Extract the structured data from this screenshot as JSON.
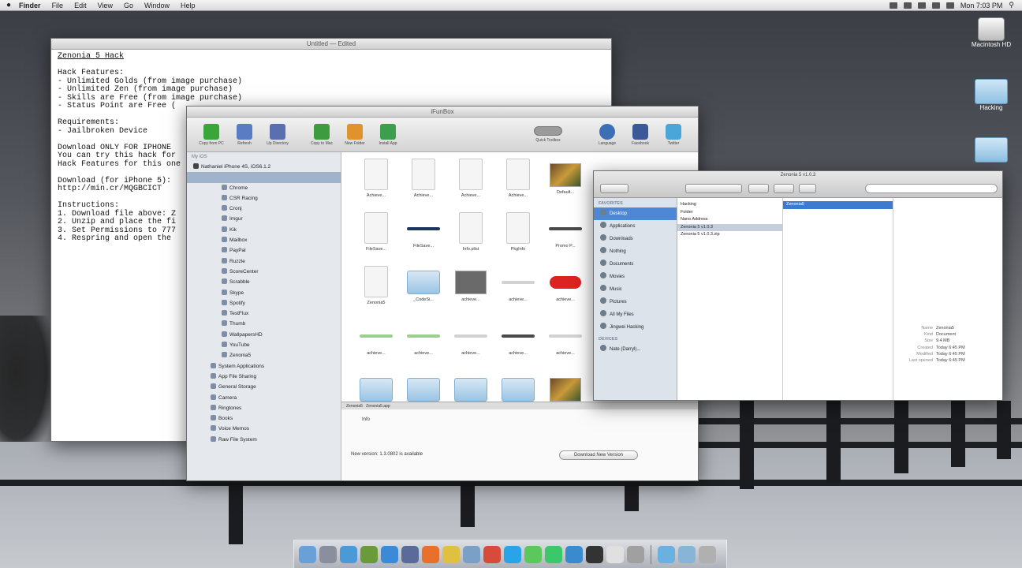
{
  "menubar": {
    "app": "Finder",
    "items": [
      "File",
      "Edit",
      "View",
      "Go",
      "Window",
      "Help"
    ],
    "clock": "Mon 7:03 PM"
  },
  "desktop": {
    "icons": [
      {
        "label": "Macintosh HD",
        "kind": "drive"
      },
      {
        "label": "Hacking",
        "kind": "folder"
      },
      {
        "label": "",
        "kind": "folder"
      }
    ]
  },
  "textedit": {
    "title": "Untitled — Edited",
    "lines": [
      "Zenonia 5 Hack",
      "",
      "Hack Features:",
      "- Unlimited Golds (from image purchase)",
      "- Unlimited Zen (from image purchase)",
      "- Skills are Free (from image purchase)",
      "- Status Point are Free (",
      "",
      "Requirements:",
      "- Jailbroken Device",
      "",
      "Download ONLY FOR IPHONE",
      "You can try this hack for",
      "Hack Features for this one",
      "",
      "Download (for iPhone 5):",
      "http://min.cr/MQGBCICT",
      "",
      "Instructions:",
      "1. Download file above: Z",
      "2. Unzip and place the fi",
      "3. Set Permissions to 777",
      "4. Respring and open the"
    ]
  },
  "ifunbox": {
    "title": "iFunBox",
    "toolbar": [
      {
        "label": "Copy from PC",
        "icon": "plus-icon",
        "color": "#3aa63a"
      },
      {
        "label": "Refresh",
        "icon": "refresh-icon",
        "color": "#5a7cc2"
      },
      {
        "label": "Up Directory",
        "icon": "up-arrow-icon",
        "color": "#5a6fb0"
      },
      {
        "label": "Copy to Mac",
        "icon": "download-icon",
        "color": "#3f9b3f"
      },
      {
        "label": "New Folder",
        "icon": "folder-new-icon",
        "color": "#e0932d"
      },
      {
        "label": "Install App",
        "icon": "install-icon",
        "color": "#3d9f4e"
      }
    ],
    "toolbar_right": [
      {
        "label": "Language",
        "icon": "globe-icon",
        "color": "#3b6fb6"
      },
      {
        "label": "Facebook",
        "icon": "facebook-icon",
        "color": "#3b5998"
      },
      {
        "label": "Twitter",
        "icon": "twitter-icon",
        "color": "#4aa6d9"
      }
    ],
    "toolbar_toggle_label": "Quick Toolbox",
    "sidebar_header": "My iOS",
    "device": "Nathaniel iPhone 4S, iOS6.1.2",
    "sidebar_items": [
      "Chrome",
      "CSR Racing",
      "Cronj",
      "Imgur",
      "Kik",
      "Mailbox",
      "PayPal",
      "Ruzzle",
      "ScoreCenter",
      "Scrabble",
      "Skype",
      "Spotify",
      "TestFlux",
      "Thumb",
      "WallpapersHD",
      "YouTube",
      "Zenonia5"
    ],
    "sidebar_groups": [
      "System Applications",
      "App File Sharing",
      "General Storage",
      "Camera",
      "Ringtones",
      "Books",
      "Voice Memos",
      "Raw File System"
    ],
    "grid": [
      {
        "label": "Achieve...",
        "kind": "doc"
      },
      {
        "label": "Achieve...",
        "kind": "doc"
      },
      {
        "label": "Achieve...",
        "kind": "doc"
      },
      {
        "label": "Achieve...",
        "kind": "doc"
      },
      {
        "label": "Default...",
        "kind": "img"
      },
      {
        "label": "FileSave...",
        "kind": "doc"
      },
      {
        "label": "FileSave...",
        "kind": "line-navy"
      },
      {
        "label": "Info.plist",
        "kind": "doc"
      },
      {
        "label": "PkgInfo",
        "kind": "doc"
      },
      {
        "label": "Promo P...",
        "kind": "line-dark"
      },
      {
        "label": "Zenonia5",
        "kind": "doc"
      },
      {
        "label": "_CodeSi...",
        "kind": "folder"
      },
      {
        "label": "achieve...",
        "kind": "gray-box"
      },
      {
        "label": "achieve...",
        "kind": "line-light"
      },
      {
        "label": "achieve...",
        "kind": "red-btn"
      },
      {
        "label": "achieve...",
        "kind": "line-green"
      },
      {
        "label": "achieve...",
        "kind": "line-green"
      },
      {
        "label": "achieve...",
        "kind": "line-light"
      },
      {
        "label": "achieve...",
        "kind": "line-dark"
      },
      {
        "label": "achieve...",
        "kind": "line-light"
      },
      {
        "label": "",
        "kind": "folder"
      },
      {
        "label": "",
        "kind": "folder"
      },
      {
        "label": "",
        "kind": "folder"
      },
      {
        "label": "",
        "kind": "folder"
      },
      {
        "label": "",
        "kind": "img"
      }
    ],
    "tabs": [
      "Zenonia5",
      "Zenonia5.app"
    ],
    "info_label": "Info",
    "update_text": "New version: 1.3.0802 is available",
    "download_button": "Download New Version"
  },
  "finder": {
    "title": "Zenonia 5 v1.0.3",
    "sidebar": {
      "favorites_header": "FAVORITES",
      "favorites": [
        "Desktop",
        "Applications",
        "Downloads",
        "Nothing",
        "Documents",
        "Movies",
        "Music",
        "Pictures",
        "All My Files",
        "Jingwei Hacking"
      ],
      "devices_header": "DEVICES",
      "devices": [
        "Nate (Darryl)..."
      ]
    },
    "column1": [
      "Hacking",
      "Folder",
      "Nano Address",
      "Zenonia 5 v1.0.3",
      "Zenonia 5 v1.0.3.zip"
    ],
    "column2": [
      "Zenonia5"
    ],
    "info": [
      {
        "k": "Name",
        "v": "Zenonia5"
      },
      {
        "k": "Kind",
        "v": "Document"
      },
      {
        "k": "Size",
        "v": "9.4 MB"
      },
      {
        "k": "Created",
        "v": "Today 6:45 PM"
      },
      {
        "k": "Modified",
        "v": "Today 6:45 PM"
      },
      {
        "k": "Last opened",
        "v": "Today 6:45 PM"
      }
    ]
  },
  "dock": {
    "items": [
      "Finder",
      "Launchpad",
      "Safari",
      "Minecraft",
      "App Store",
      "Xcode",
      "Firefox",
      "Chrome",
      "Mail",
      "Calendar",
      "Skype",
      "Messages",
      "FaceTime",
      "iFunBox",
      "Terminal",
      "TextEdit",
      "Stacks",
      "Downloads",
      "Documents",
      "Trash"
    ]
  },
  "colors": {
    "accent": "#4c88d6",
    "selection": "#9fb4cc"
  }
}
